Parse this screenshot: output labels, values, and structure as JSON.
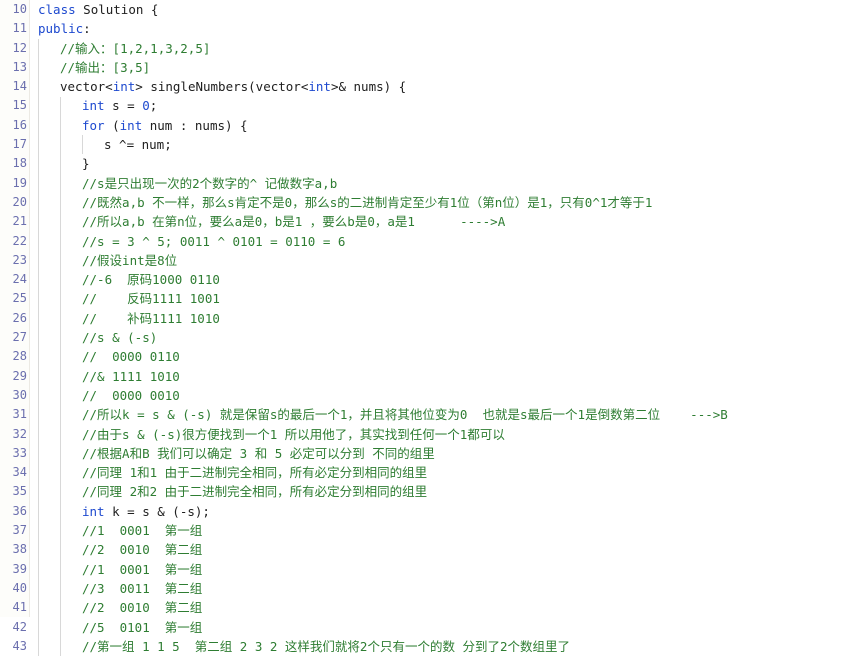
{
  "editor": {
    "name": "code-editor",
    "language": "cpp",
    "background": "#ffffff",
    "gutter_background": "#fdfdfa",
    "colors": {
      "keyword": "#1d49cf",
      "comment": "#2e7d32",
      "number": "#1d49cf",
      "text": "#202020",
      "line_number": "#6b6fae",
      "indent_guide": "#d8d8d8"
    },
    "first_line_number": 10,
    "last_line_number": 43
  },
  "lines": [
    {
      "no": "10",
      "indent": 0,
      "tokens": [
        {
          "t": "class",
          "c": "kw"
        },
        {
          "t": " Solution {",
          "c": "plain"
        }
      ]
    },
    {
      "no": "11",
      "indent": 0,
      "tokens": [
        {
          "t": "public",
          "c": "kw"
        },
        {
          "t": ":",
          "c": "plain"
        }
      ]
    },
    {
      "no": "12",
      "indent": 1,
      "tokens": [
        {
          "t": "//输入：[1,2,1,3,2,5]",
          "c": "cmt"
        }
      ]
    },
    {
      "no": "13",
      "indent": 1,
      "tokens": [
        {
          "t": "//输出：[3,5]",
          "c": "cmt"
        }
      ]
    },
    {
      "no": "14",
      "indent": 1,
      "tokens": [
        {
          "t": "vector<",
          "c": "plain"
        },
        {
          "t": "int",
          "c": "kw"
        },
        {
          "t": "> singleNumbers(vector<",
          "c": "plain"
        },
        {
          "t": "int",
          "c": "kw"
        },
        {
          "t": ">& nums) {",
          "c": "plain"
        }
      ]
    },
    {
      "no": "15",
      "indent": 2,
      "tokens": [
        {
          "t": "int",
          "c": "kw"
        },
        {
          "t": " s = ",
          "c": "plain"
        },
        {
          "t": "0",
          "c": "num"
        },
        {
          "t": ";",
          "c": "plain"
        }
      ]
    },
    {
      "no": "16",
      "indent": 2,
      "tokens": [
        {
          "t": "for",
          "c": "kw"
        },
        {
          "t": " (",
          "c": "plain"
        },
        {
          "t": "int",
          "c": "kw"
        },
        {
          "t": " num : nums) {",
          "c": "plain"
        }
      ]
    },
    {
      "no": "17",
      "indent": 3,
      "tokens": [
        {
          "t": "s ^= num;",
          "c": "plain"
        }
      ]
    },
    {
      "no": "18",
      "indent": 2,
      "tokens": [
        {
          "t": "}",
          "c": "plain"
        }
      ]
    },
    {
      "no": "19",
      "indent": 2,
      "tokens": [
        {
          "t": "//s是只出现一次的2个数字的^ 记做数字a,b",
          "c": "cmt"
        }
      ]
    },
    {
      "no": "20",
      "indent": 2,
      "tokens": [
        {
          "t": "//既然a,b 不一样，那么s肯定不是0，那么s的二进制肯定至少有1位（第n位）是1，只有0^1才等于1",
          "c": "cmt"
        }
      ]
    },
    {
      "no": "21",
      "indent": 2,
      "tokens": [
        {
          "t": "//所以a,b 在第n位，要么a是0，b是1 ，要么b是0，a是1      ---->A",
          "c": "cmt"
        }
      ]
    },
    {
      "no": "22",
      "indent": 2,
      "tokens": [
        {
          "t": "//s = 3 ^ 5; 0011 ^ 0101 = 0110 = 6",
          "c": "cmt"
        }
      ]
    },
    {
      "no": "23",
      "indent": 2,
      "tokens": [
        {
          "t": "//假设int是8位",
          "c": "cmt"
        }
      ]
    },
    {
      "no": "24",
      "indent": 2,
      "tokens": [
        {
          "t": "//-6  原码1000 0110",
          "c": "cmt"
        }
      ]
    },
    {
      "no": "25",
      "indent": 2,
      "tokens": [
        {
          "t": "//    反码1111 1001",
          "c": "cmt"
        }
      ]
    },
    {
      "no": "26",
      "indent": 2,
      "tokens": [
        {
          "t": "//    补码1111 1010",
          "c": "cmt"
        }
      ]
    },
    {
      "no": "27",
      "indent": 2,
      "tokens": [
        {
          "t": "//s & (-s)",
          "c": "cmt"
        }
      ]
    },
    {
      "no": "28",
      "indent": 2,
      "tokens": [
        {
          "t": "//  0000 0110",
          "c": "cmt"
        }
      ]
    },
    {
      "no": "29",
      "indent": 2,
      "tokens": [
        {
          "t": "//& 1111 1010",
          "c": "cmt"
        }
      ]
    },
    {
      "no": "30",
      "indent": 2,
      "tokens": [
        {
          "t": "//  0000 0010",
          "c": "cmt"
        }
      ]
    },
    {
      "no": "31",
      "indent": 2,
      "tokens": [
        {
          "t": "//所以k = s & (-s) 就是保留s的最后一个1，并且将其他位变为0  也就是s最后一个1是倒数第二位    --->B",
          "c": "cmt"
        }
      ]
    },
    {
      "no": "32",
      "indent": 2,
      "tokens": [
        {
          "t": "//由于s & (-s)很方便找到一个1 所以用他了，其实找到任何一个1都可以",
          "c": "cmt"
        }
      ]
    },
    {
      "no": "33",
      "indent": 2,
      "tokens": [
        {
          "t": "//根据A和B 我们可以确定 3 和 5 必定可以分到 不同的组里",
          "c": "cmt"
        }
      ]
    },
    {
      "no": "34",
      "indent": 2,
      "tokens": [
        {
          "t": "//同理 1和1 由于二进制完全相同，所有必定分到相同的组里",
          "c": "cmt"
        }
      ]
    },
    {
      "no": "35",
      "indent": 2,
      "tokens": [
        {
          "t": "//同理 2和2 由于二进制完全相同，所有必定分到相同的组里",
          "c": "cmt"
        }
      ]
    },
    {
      "no": "36",
      "indent": 2,
      "tokens": [
        {
          "t": "int",
          "c": "kw"
        },
        {
          "t": " k = s & (-s);",
          "c": "plain"
        }
      ]
    },
    {
      "no": "37",
      "indent": 2,
      "tokens": [
        {
          "t": "//1  0001  第一组",
          "c": "cmt"
        }
      ]
    },
    {
      "no": "38",
      "indent": 2,
      "tokens": [
        {
          "t": "//2  0010  第二组",
          "c": "cmt"
        }
      ]
    },
    {
      "no": "39",
      "indent": 2,
      "tokens": [
        {
          "t": "//1  0001  第一组",
          "c": "cmt"
        }
      ]
    },
    {
      "no": "40",
      "indent": 2,
      "tokens": [
        {
          "t": "//3  0011  第二组",
          "c": "cmt"
        }
      ]
    },
    {
      "no": "41",
      "indent": 2,
      "tokens": [
        {
          "t": "//2  0010  第二组",
          "c": "cmt"
        }
      ]
    },
    {
      "no": "42",
      "indent": 2,
      "tokens": [
        {
          "t": "//5  0101  第一组",
          "c": "cmt"
        }
      ]
    },
    {
      "no": "43",
      "indent": 2,
      "tokens": [
        {
          "t": "//第一组 1 1 5  第二组 2 3 2 这样我们就将2个只有一个的数 分到了2个数组里了",
          "c": "cmt"
        }
      ]
    }
  ]
}
